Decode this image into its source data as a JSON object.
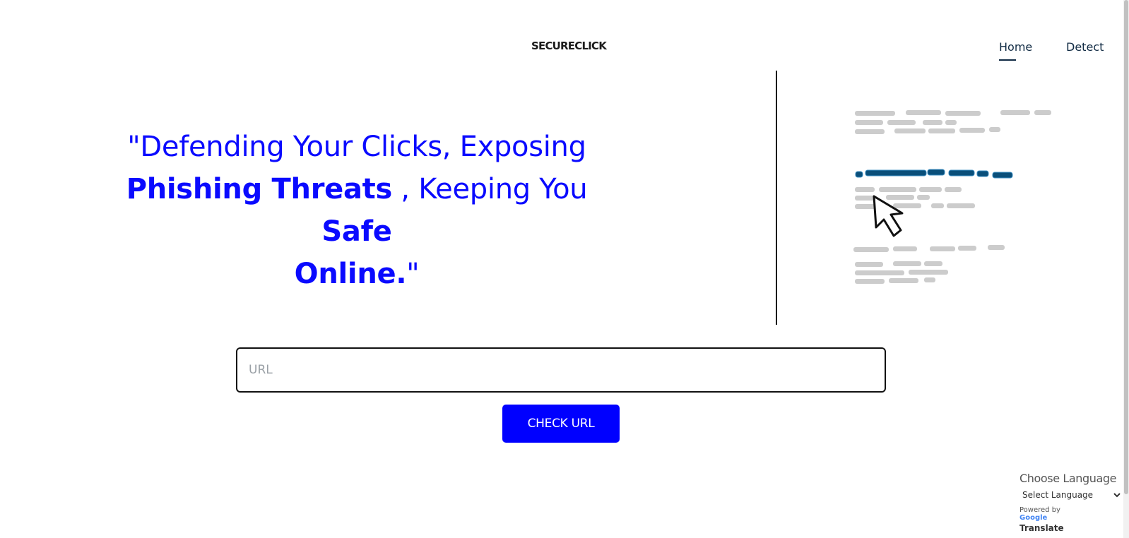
{
  "header": {
    "brand": "SECURECLICK",
    "nav": [
      {
        "label": "Home",
        "active": true
      },
      {
        "label": "Detect",
        "active": false
      }
    ]
  },
  "hero": {
    "quote_open": "\"Defending Your Clicks, Exposing",
    "bold_1": "Phishing Threats",
    "mid": " , Keeping You ",
    "bold_2": "Safe",
    "bold_3": "Online.",
    "quote_close": "\""
  },
  "form": {
    "url_placeholder": "URL",
    "url_value": "",
    "submit_label": "CHECK URL"
  },
  "translate": {
    "heading": "Choose Language",
    "select_label": "Select Language",
    "powered_by": "Powered by",
    "google": "Google",
    "translate": "Translate"
  },
  "colors": {
    "accent": "#0000ff",
    "headline": "#0a0aff",
    "nav_text": "#102a43",
    "highlight_line": "#0a4f7a",
    "placeholder_bars": "#cccccc"
  }
}
